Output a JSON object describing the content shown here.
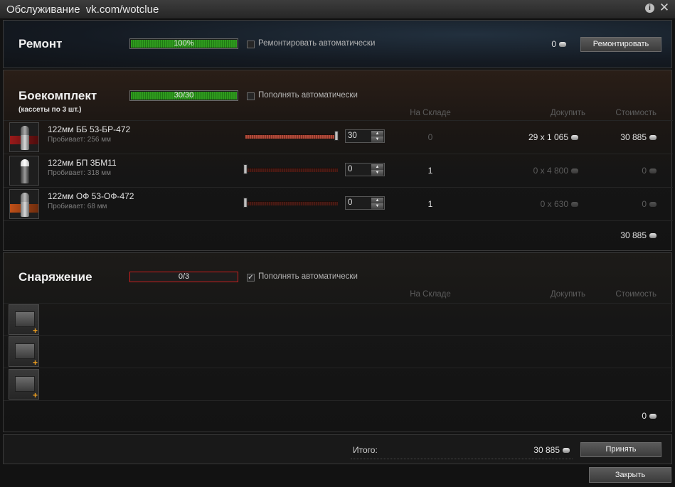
{
  "window": {
    "title": "Обслуживание",
    "subtitle": "vk.com/wotclue",
    "info_glyph": "i",
    "close_glyph": "✕"
  },
  "repair": {
    "title": "Ремонт",
    "progress_label": "100%",
    "progress_fraction": 1.0,
    "auto_label": "Ремонтировать автоматически",
    "auto_checked": false,
    "cost": "0",
    "button_label": "Ремонтировать"
  },
  "ammo": {
    "title": "Боекомплект",
    "subtitle": "(кассеты по 3 шт.)",
    "progress_label": "30/30",
    "progress_fraction": 1.0,
    "auto_label": "Пополнять автоматически",
    "auto_checked": false,
    "columns": [
      "На Складе",
      "Докупить",
      "Стоимость"
    ],
    "rows": [
      {
        "name": "122мм ББ 53-БР-472",
        "pen": "Пробивает: 256 мм",
        "qty": "30",
        "slider_fraction": 1.0,
        "stock": "0",
        "buy": "29 x 1 065",
        "cost": "30 885",
        "icon": "ap-shell-icon"
      },
      {
        "name": "122мм БП 3БМ11",
        "pen": "Пробивает: 318 мм",
        "qty": "0",
        "slider_fraction": 0.0,
        "stock": "1",
        "buy": "0 x 4 800",
        "cost": "0",
        "icon": "apcr-shell-icon"
      },
      {
        "name": "122мм ОФ 53-ОФ-472",
        "pen": "Пробивает: 68 мм",
        "qty": "0",
        "slider_fraction": 0.0,
        "stock": "1",
        "buy": "0 x 630",
        "cost": "0",
        "icon": "he-shell-icon"
      }
    ],
    "subtotal": "30 885"
  },
  "equipment": {
    "title": "Снаряжение",
    "progress_label": "0/3",
    "progress_fraction": 0.0,
    "auto_label": "Пополнять автоматически",
    "auto_checked": true,
    "check_glyph": "✓",
    "columns": [
      "На Складе",
      "Докупить",
      "Стоимость"
    ],
    "slots": [
      {
        "icon": "empty-equipment-slot-icon",
        "plus": "+"
      },
      {
        "icon": "empty-equipment-slot-icon",
        "plus": "+"
      },
      {
        "icon": "empty-equipment-slot-icon",
        "plus": "+"
      }
    ],
    "subtotal": "0"
  },
  "footer": {
    "total_label": "Итого:",
    "total_value": "30 885",
    "accept_label": "Принять",
    "close_label": "Закрыть"
  },
  "colors": {
    "progress_green": "#2f9a1e",
    "progress_red_border": "#c81e1e",
    "slider_full": "#b14a39",
    "plus_orange": "#f0a020"
  },
  "icons": {
    "credits": "credits-icon"
  }
}
